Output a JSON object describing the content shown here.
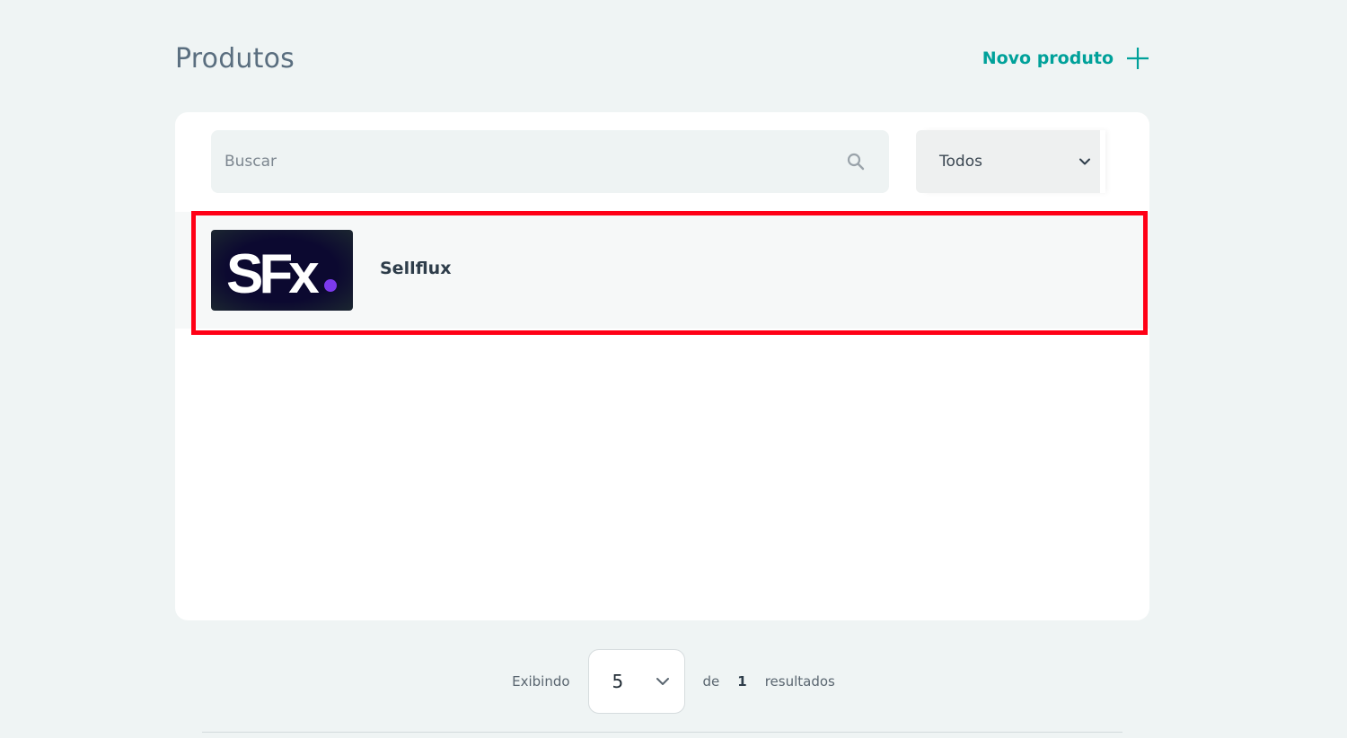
{
  "header": {
    "title": "Produtos",
    "new_product_label": "Novo produto"
  },
  "search": {
    "placeholder": "Buscar",
    "value": ""
  },
  "filter": {
    "selected": "Todos"
  },
  "products": [
    {
      "name": "Sellflux",
      "logo_text": "SFx"
    }
  ],
  "pagination": {
    "showing_label": "Exibindo",
    "per_page": "5",
    "of_label": "de",
    "total": "1",
    "results_label": "resultados"
  },
  "colors": {
    "accent": "#00a19a",
    "highlight_border": "#ff0016",
    "logo_bg": "#0c0930",
    "logo_dot": "#7c3aed"
  }
}
